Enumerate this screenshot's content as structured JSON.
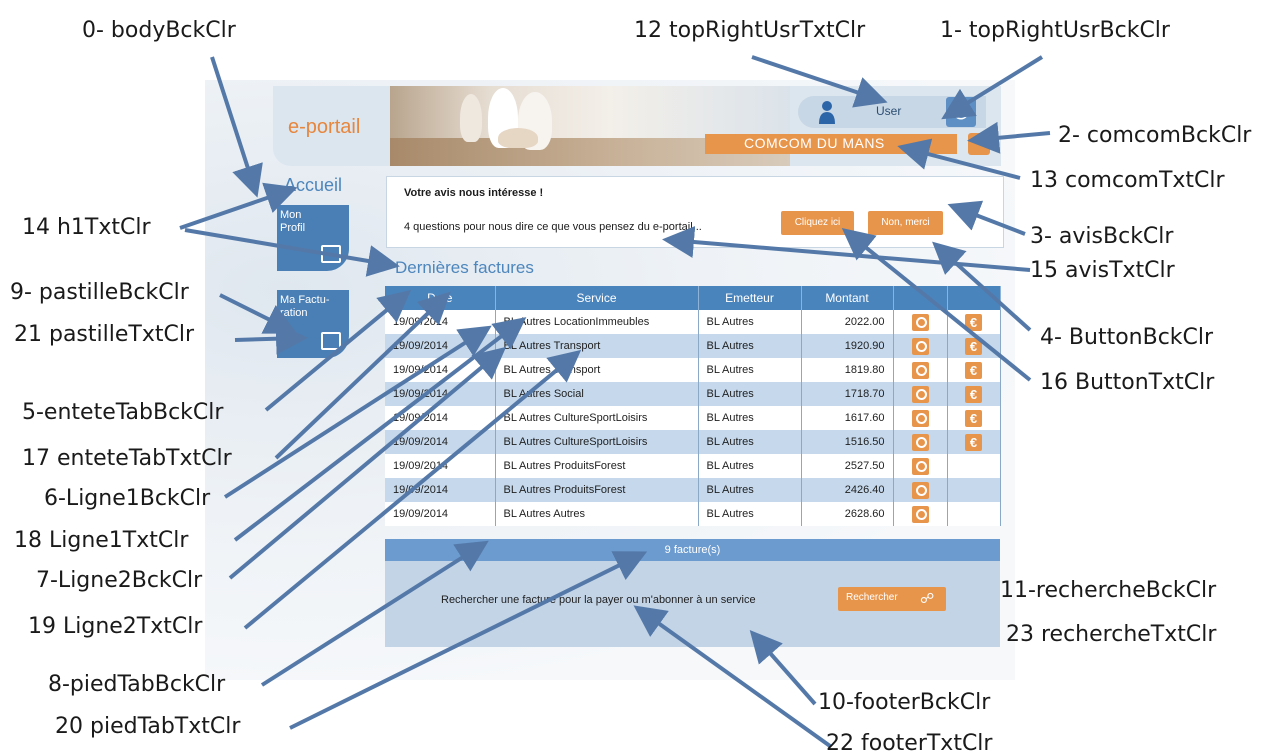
{
  "annotations": [
    "0- bodyBckClr",
    "12 topRightUsrTxtClr",
    "1- topRightUsrBckClr",
    "2- comcomBckClr",
    "13 comcomTxtClr",
    "3- avisBckClr",
    "14 h1TxtClr",
    "15 avisTxtClr",
    "9- pastilleBckClr",
    "21 pastilleTxtClr",
    "4- ButtonBckClr",
    "16 ButtonTxtClr",
    "5-enteteTabBckClr",
    "17 enteteTabTxtClr",
    "6-Ligne1BckClr",
    "18 Ligne1TxtClr",
    "7-Ligne2BckClr",
    "19 Ligne2TxtClr",
    "11-rechercheBckClr",
    "23 rechercheTxtClr",
    "8-piedTabBckClr",
    "20 piedTabTxtClr",
    "10-footerBckClr",
    "22 footerTxtClr"
  ],
  "portal": {
    "logo": "e-portail",
    "user": "User",
    "collectivite": "COMCOM DU MANS",
    "accueil": "Accueil",
    "pastilles": [
      "Mon Profil",
      "Ma Factu-ration"
    ],
    "avis": {
      "title": "Votre avis nous intéresse !",
      "text": "4 questions pour nous dire ce que vous pensez du e-portail...",
      "btn_yes": "Cliquez ici",
      "btn_no": "Non, merci"
    },
    "section_title": "Dernières factures",
    "table": {
      "headers": [
        "Date",
        "Service",
        "Emetteur",
        "Montant",
        "",
        ""
      ],
      "rows": [
        {
          "date": "19/09/2014",
          "service": "BL Autres LocationImmeubles",
          "emetteur": "BL Autres",
          "montant": "2022.00",
          "pay": true
        },
        {
          "date": "19/09/2014",
          "service": "BL Autres Transport",
          "emetteur": "BL Autres",
          "montant": "1920.90",
          "pay": true
        },
        {
          "date": "19/09/2014",
          "service": "BL Autres Transport",
          "emetteur": "BL Autres",
          "montant": "1819.80",
          "pay": true
        },
        {
          "date": "19/09/2014",
          "service": "BL Autres Social",
          "emetteur": "BL Autres",
          "montant": "1718.70",
          "pay": true
        },
        {
          "date": "19/09/2014",
          "service": "BL Autres CultureSportLoisirs",
          "emetteur": "BL Autres",
          "montant": "1617.60",
          "pay": true
        },
        {
          "date": "19/09/2014",
          "service": "BL Autres CultureSportLoisirs",
          "emetteur": "BL Autres",
          "montant": "1516.50",
          "pay": true
        },
        {
          "date": "19/09/2014",
          "service": "BL Autres ProduitsForest",
          "emetteur": "BL Autres",
          "montant": "2527.50",
          "pay": false
        },
        {
          "date": "19/09/2014",
          "service": "BL Autres ProduitsForest",
          "emetteur": "BL Autres",
          "montant": "2426.40",
          "pay": false
        },
        {
          "date": "19/09/2014",
          "service": "BL Autres Autres",
          "emetteur": "BL Autres",
          "montant": "2628.60",
          "pay": false
        }
      ],
      "footer": "9 facture(s)"
    },
    "footer": {
      "text": "Rechercher une facture pour la payer ou m'abonner à un service",
      "button": "Rechercher"
    }
  },
  "colors": {
    "orange": "#e8954c",
    "blue": "#4a84bd",
    "light_blue_row": "#c5d8ec",
    "footer": "#c3d4e7",
    "arrow": "#5479a8"
  }
}
